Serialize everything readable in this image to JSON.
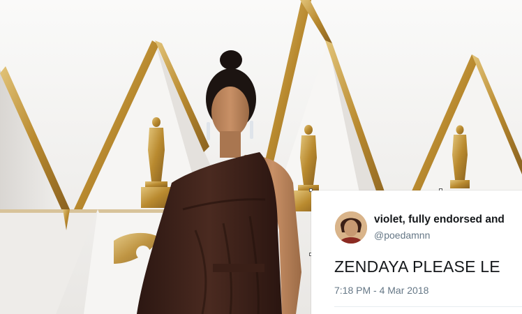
{
  "tweet": {
    "display_name": "violet, fully endorsed and",
    "handle": "@poedamnn",
    "text": "ZENDAYA PLEASE LE",
    "timestamp": "7:18 PM - 4 Mar 2018"
  },
  "icons": {
    "avatar": "profile-avatar",
    "statuette": "award-statuette-icon"
  },
  "colors": {
    "gown": "#3b2018",
    "gold": "#c79a3c",
    "wall": "#f4f3f1",
    "tweet_text": "#14171a",
    "tweet_secondary": "#657786"
  }
}
